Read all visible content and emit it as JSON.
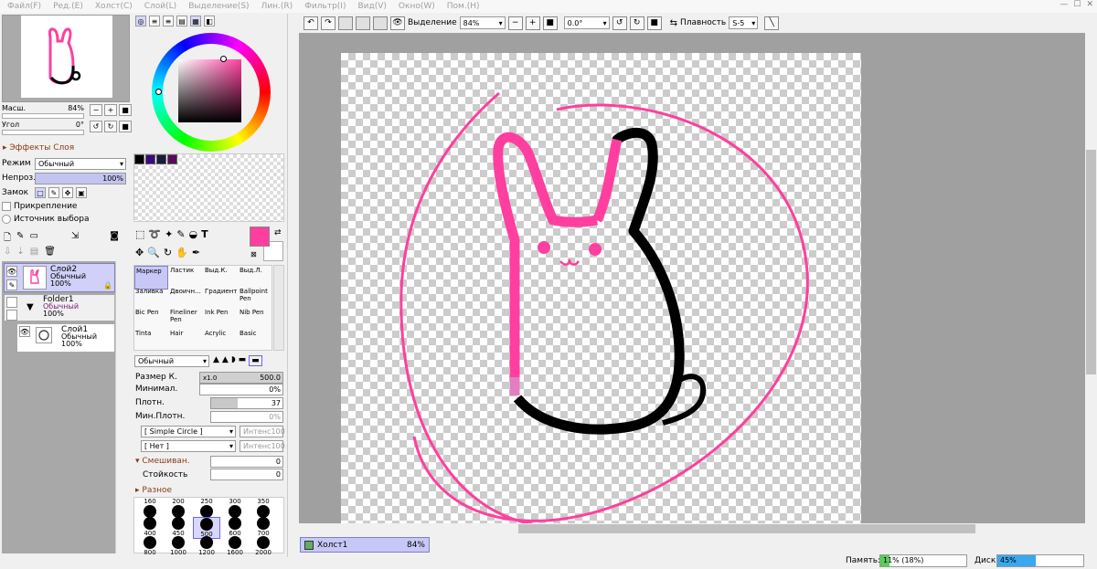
{
  "menu": [
    "Файл(F)",
    "Ред.(E)",
    "Холст(C)",
    "Слой(L)",
    "Выделение(S)",
    "Лин.(R)",
    "Фильтр(I)",
    "Вид(V)",
    "Окно(W)",
    "Пом.(H)"
  ],
  "navigator": {
    "zoom_label": "Масш.",
    "zoom_value": "84%",
    "angle_label": "Угол",
    "angle_value": "0°"
  },
  "layer_panel": {
    "effects_title": "Эффекты Слоя",
    "mode_label": "Режим",
    "mode_value": "Обычный",
    "opacity_label": "Непроз.",
    "opacity_value": "100%",
    "lock_label": "Замок",
    "clip_label": "Прикрепление",
    "source_label": "Источник выбора",
    "layers": [
      {
        "name": "Слой2",
        "mode": "Обычный",
        "opacity": "100%"
      },
      {
        "name": "Folder1",
        "mode": "Обычный",
        "opacity": "100%"
      },
      {
        "name": "Слой1",
        "mode": "Обычный",
        "opacity": "100%"
      }
    ]
  },
  "colors": {
    "main": "#ff3f9f",
    "swatches": [
      "#000000",
      "#3a0a7a",
      "#1a1a3a",
      "#5a0a5a"
    ]
  },
  "tools": {
    "grid": [
      [
        "Маркер",
        "Ластик",
        "Выд.К.",
        "Выд.Л."
      ],
      [
        "Заливка",
        "Двоичн...",
        "Градиент",
        "Ballpoint Pen"
      ],
      [
        "Bic Pen",
        "Fineliner Pen",
        "Ink Pen",
        "Nib Pen"
      ],
      [
        "Tinta",
        "Hair",
        "Acrylic",
        "Basic"
      ]
    ],
    "blend_value": "Обычный",
    "size_label": "Размер К.",
    "size_mult": "x1.0",
    "size_value": "500.0",
    "min_label": "Минимал.",
    "min_value": "0%",
    "density_label": "Плотн.",
    "density_value": "37",
    "min_density_label": "Мин.Плотн.",
    "min_density_value": "0%",
    "shape_value": "[ Simple Circle ]",
    "texture_value": "[ Нет ]",
    "intensity_label": "Интенс",
    "intensity_value": "100",
    "blend_section": "Смешиван.",
    "blend_amount": "0",
    "persistence_label": "Стойкость",
    "persistence_value": "0",
    "misc_section": "Разное",
    "sizes": [
      "160",
      "200",
      "250",
      "300",
      "350",
      "400",
      "450",
      "500",
      "600",
      "700",
      "800",
      "1000",
      "1200",
      "1600",
      "2000"
    ]
  },
  "toolbar": {
    "selection_label": "Выделение",
    "zoom": "84%",
    "angle": "0.0°",
    "smooth_label": "Плавность",
    "smooth_value": "S-5"
  },
  "canvas_tab": {
    "name": "Холст1",
    "zoom": "84%"
  },
  "status": {
    "memory_label": "Память:",
    "memory_value": "11% (18%)",
    "memory_pct": 0.11,
    "disk_label": "Диск:",
    "disk_value": "45%",
    "disk_pct": 0.45
  }
}
